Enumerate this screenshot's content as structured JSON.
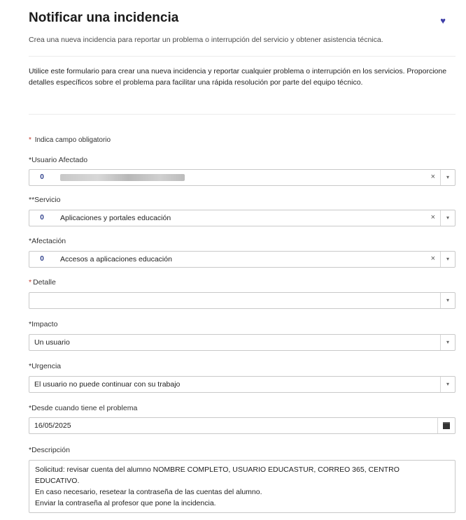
{
  "header": {
    "title": "Notificar una incidencia",
    "subtitle": "Crea una nueva incidencia para reportar un problema o interrupción del servicio y obtener asistencia técnica."
  },
  "intro": "Utilice este formulario para crear una nueva incidencia y reportar cualquier problema o interrupción en los servicios.  Proporcione detalles específicos sobre el problema para facilitar una rápida resolución por parte del equipo técnico.",
  "required_note": "Indica campo obligatorio",
  "fields": {
    "usuario": {
      "label": "Usuario Afectado"
    },
    "servicio": {
      "label": "*Servicio",
      "value": "Aplicaciones y portales educación"
    },
    "afectacion": {
      "label": "Afectación",
      "value": "Accesos a aplicaciones educación"
    },
    "detalle": {
      "label": "Detalle",
      "value": ""
    },
    "impacto": {
      "label": "Impacto",
      "value": "Un usuario"
    },
    "urgencia": {
      "label": "Urgencia",
      "value": "El usuario no puede continuar con su trabajo"
    },
    "desde": {
      "label": "Desde cuando tiene el problema",
      "value": "16/05/2025"
    },
    "descripcion": {
      "label": "Descripción",
      "lines": [
        "Solicitud: revisar cuenta del alumno NOMBRE COMPLETO, USUARIO EDUCASTUR, CORREO 365, CENTRO",
        "EDUCATIVO.",
        "En caso necesario, resetear la contraseña de las cuentas del alumno.",
        "Enviar la contraseña al profesor que pone la incidencia."
      ]
    }
  },
  "icons": {
    "heart": "heart-icon",
    "info": "info-icon",
    "clear": "clear-icon",
    "dropdown": "chevron-down-icon",
    "calendar": "calendar-icon"
  },
  "symbols": {
    "heart": "♥",
    "info": "0",
    "clear": "×",
    "dropdown": "▾",
    "required": "*"
  },
  "colors": {
    "required": "#c0392b",
    "accent": "#3f3fa8",
    "info": "#2d3e8a"
  }
}
